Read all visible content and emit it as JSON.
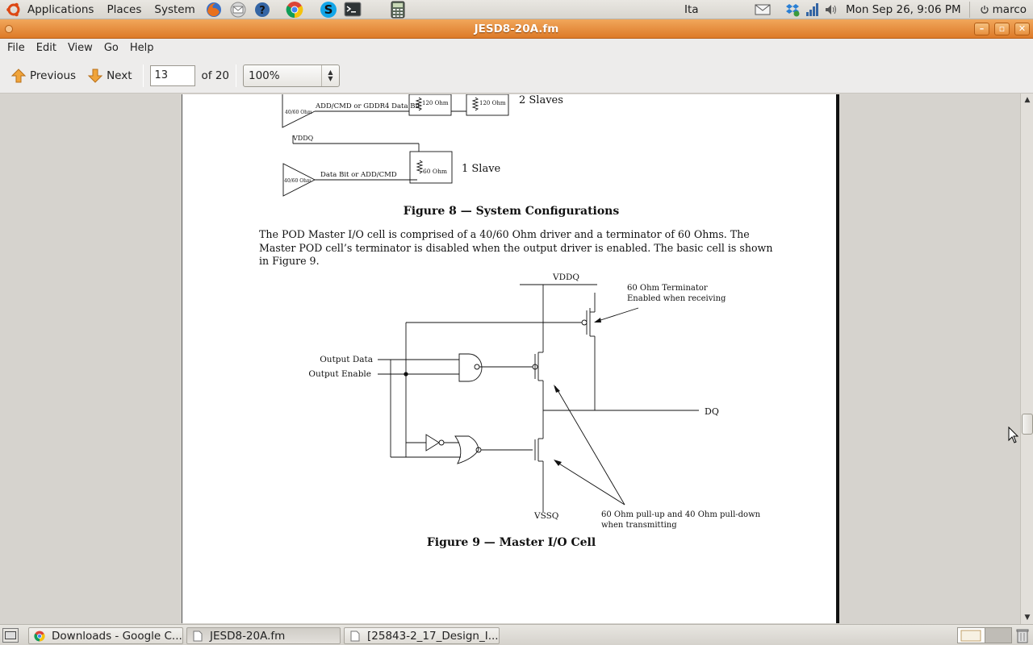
{
  "top_panel": {
    "applications": "Applications",
    "places": "Places",
    "system": "System",
    "keyboard_layout": "Ita",
    "datetime": "Mon Sep 26,  9:06 PM",
    "user": "marco"
  },
  "window": {
    "title": "JESD8-20A.fm"
  },
  "menubar": {
    "file": "File",
    "edit": "Edit",
    "view": "View",
    "go": "Go",
    "help": "Help"
  },
  "toolbar": {
    "previous_label": "Previous",
    "next_label": "Next",
    "page_value": "13",
    "page_of": "of 20",
    "zoom_value": "100%"
  },
  "document": {
    "fig8_labels": {
      "driver_top": "40/60 Ohm",
      "signal_top": "ADD/CMD or GDDR4 Data Bit",
      "res_120_a": "120 Ohm",
      "res_120_b": "120 Ohm",
      "two_slaves": "2 Slaves",
      "vddq": "VDDQ",
      "driver_bottom": "40/60 Ohm",
      "signal_bottom": "Data Bit or ADD/CMD",
      "res_60": "60 Ohm",
      "one_slave": "1 Slave"
    },
    "fig8_caption": "Figure 8 — System Configurations",
    "paragraph": "The POD Master I/O cell is comprised of a 40/60 Ohm driver and a terminator of 60 Ohms. The Master POD cell’s terminator is disabled when the output driver is enabled. The basic cell is shown in Figure 9.",
    "fig9_labels": {
      "vddq": "VDDQ",
      "terminator_line1": "60 Ohm Terminator",
      "terminator_line2": "Enabled when receiving",
      "output_data": "Output Data",
      "output_enable": "Output Enable",
      "dq": "DQ",
      "vssq": "VSSQ",
      "pull_line1": "60 Ohm pull-up  and 40 Ohm pull-down",
      "pull_line2": "when transmitting"
    },
    "fig9_caption": "Figure 9 — Master I/O Cell"
  },
  "taskbar": {
    "items": [
      "Downloads - Google C...",
      "JESD8-20A.fm",
      "[25843-2_17_Design_I..."
    ]
  },
  "colors": {
    "titlebar": "#e08a3a",
    "panel": "#dedbd5",
    "page": "#ffffff"
  }
}
